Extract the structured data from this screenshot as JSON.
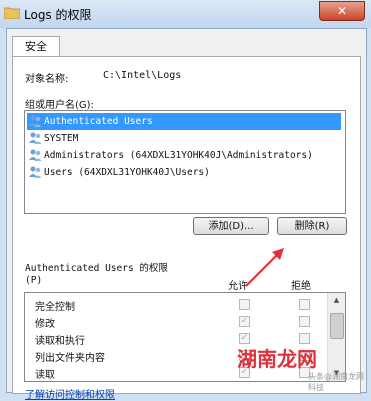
{
  "window": {
    "title": "Logs 的权限",
    "close_glyph": "✕"
  },
  "tabs": [
    "安全"
  ],
  "security": {
    "object_label": "对象名称:",
    "object_value": "C:\\Intel\\Logs",
    "group_label": "组或用户名(G):",
    "users": [
      {
        "name": "Authenticated Users",
        "selected": true
      },
      {
        "name": "SYSTEM",
        "selected": false
      },
      {
        "name": "Administrators (64XDXL31YOHK40J\\Administrators)",
        "selected": false
      },
      {
        "name": "Users (64XDXL31YOHK40J\\Users)",
        "selected": false
      }
    ],
    "add_button": "添加(D)...",
    "remove_button": "删除(R)",
    "permissions_title_line1": "Authenticated Users 的权限",
    "permissions_title_line2": "(P)",
    "allow_header": "允许",
    "deny_header": "拒绝",
    "permissions": [
      {
        "name": "完全控制",
        "allow": false,
        "deny": false
      },
      {
        "name": "修改",
        "allow": true,
        "deny": false
      },
      {
        "name": "读取和执行",
        "allow": true,
        "deny": false
      },
      {
        "name": "列出文件夹内容",
        "allow": true,
        "deny": false
      },
      {
        "name": "读取",
        "allow": true,
        "deny": false
      }
    ],
    "link_text": "了解访问控制和权限"
  },
  "watermark": {
    "main": "湖南龙网",
    "sub": "头条@湖南龙网科技"
  },
  "colors": {
    "selection": "#3399ff",
    "annotation_arrow": "#e0303a"
  }
}
